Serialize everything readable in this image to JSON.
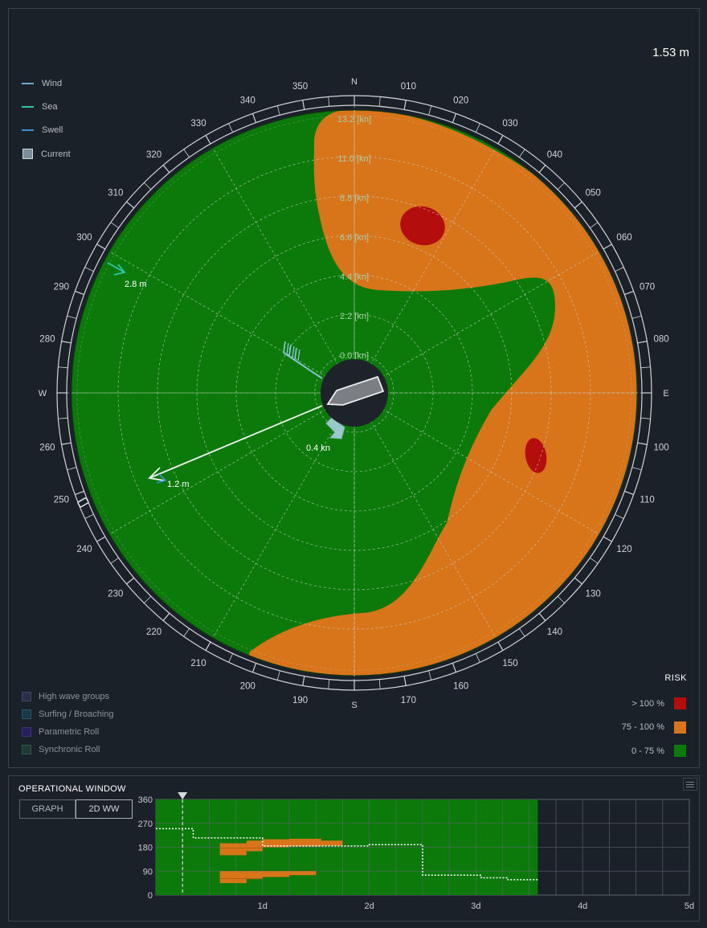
{
  "wave_height": "1.53 m",
  "legend": {
    "wind": {
      "label": "Wind",
      "color": "#6fa8c8"
    },
    "sea": {
      "label": "Sea",
      "color": "#2fc6a8"
    },
    "swell": {
      "label": "Swell",
      "color": "#3f8fd8"
    },
    "current": {
      "label": "Current"
    }
  },
  "hazards": [
    {
      "label": "High wave groups",
      "color": "#2a2f4a"
    },
    {
      "label": "Surfing / Broaching",
      "color": "#17394a"
    },
    {
      "label": "Parametric Roll",
      "color": "#25205a"
    },
    {
      "label": "Synchronic Roll",
      "color": "#1d3a34"
    }
  ],
  "risk": {
    "title": "RISK",
    "levels": [
      {
        "label": "> 100 %",
        "color": "#b40d0d"
      },
      {
        "label": "75 - 100 %",
        "color": "#d8741a"
      },
      {
        "label": "0 - 75 %",
        "color": "#0b7a0b"
      }
    ]
  },
  "compass": {
    "cardinals": [
      "N",
      "E",
      "S",
      "W"
    ],
    "degree_labels": [
      "010",
      "020",
      "030",
      "040",
      "050",
      "060",
      "070",
      "080",
      "100",
      "110",
      "120",
      "130",
      "140",
      "150",
      "160",
      "170",
      "190",
      "200",
      "210",
      "220",
      "230",
      "240",
      "250",
      "260",
      "280",
      "290",
      "300",
      "310",
      "320",
      "330",
      "340",
      "350"
    ],
    "speed_rings": [
      "0.0 [kn]",
      "2.2 [kn]",
      "4.4 [kn]",
      "6.6 [kn]",
      "8.8 [kn]",
      "11.0 [kn]",
      "13.2 [kn]"
    ]
  },
  "vectors": {
    "sea_label": "2.8 m",
    "swell_label": "1.2 m",
    "current_label": "0.4 kn"
  },
  "operational_window": {
    "title": "OPERATIONAL WINDOW",
    "buttons": [
      "GRAPH",
      "2D WW"
    ],
    "selected_button": "2D WW",
    "y_ticks": [
      "360",
      "270",
      "180",
      "90",
      "0"
    ],
    "x_ticks": [
      "1d",
      "2d",
      "3d",
      "4d",
      "5d"
    ]
  }
}
